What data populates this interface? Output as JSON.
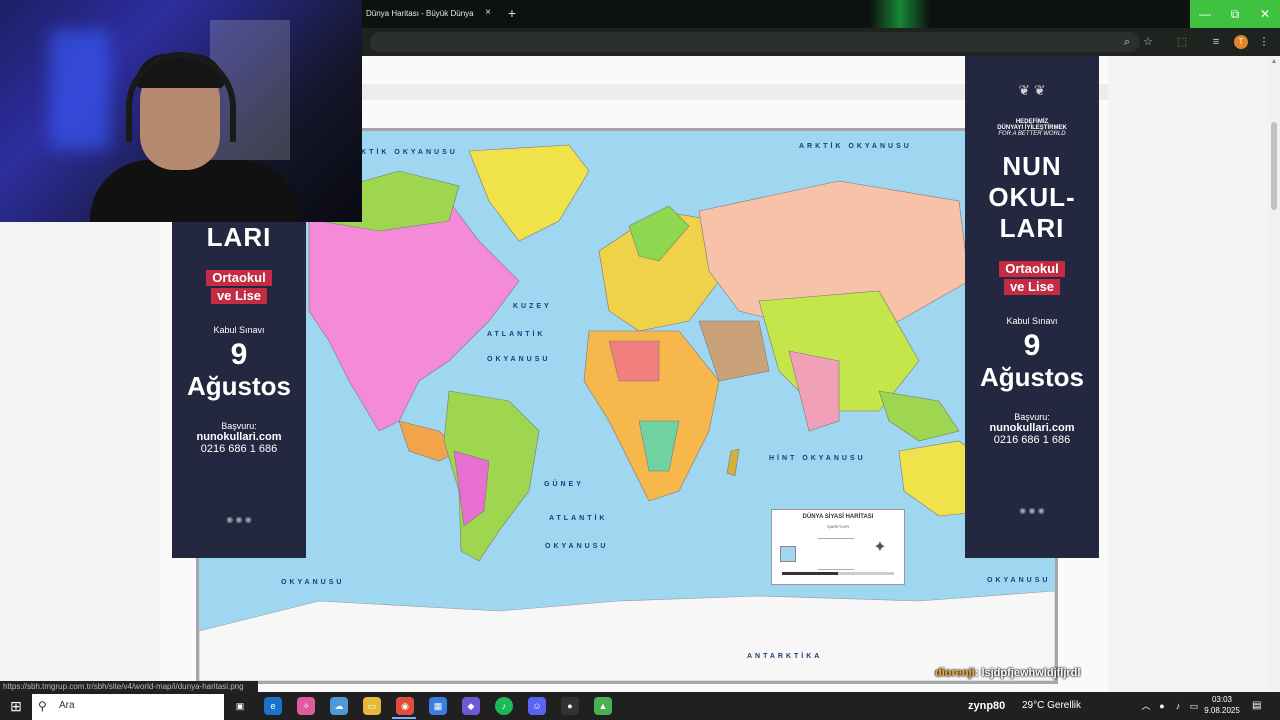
{
  "browser": {
    "tab_title": "Dünya Haritası - Büyük Dünya",
    "tab_close": "×",
    "new_tab": "+",
    "profile_initial": "T",
    "window_buttons": [
      "—",
      "⧉",
      "✕"
    ],
    "status_url": "https://sbh.tmgrup.com.tr/sbh/site/v4/world-map/i/dunya-haritasi.png"
  },
  "map": {
    "oceans": [
      "ARKTİK OKYANUSU",
      "ARKTİK OKYANUSU",
      "KUZEY",
      "ATLANTİK",
      "OKYANUSU",
      "HİNT OKYANUSU",
      "GÜNEY",
      "ATLANTİK",
      "OKYANUSU",
      "ANTARKTİKA",
      "OKYANUSU",
      "OKYANUSU"
    ],
    "legend_title": "DÜNYA SİYASİ HARİTASI",
    "legend_sub": "İŞARETLER"
  },
  "ad_left": {
    "title_part": "LARI",
    "red": [
      "Ortaokul",
      "ve Lise"
    ],
    "exam": "Kabul Sınavı",
    "day": "9",
    "month": "Ağustos",
    "apply": "Başvuru:",
    "site": "nunokullari.com",
    "phone": "0216 686 1 686"
  },
  "ad_right": {
    "slogan1": "HEDEFİMİZ",
    "slogan2": "DÜNYAYI İYİLEŞTİRMEK",
    "slogan3": "FOR A BETTER WORLD",
    "title": [
      "NUN",
      "OKUL-",
      "LARI"
    ],
    "red": [
      "Ortaokul",
      "ve Lise"
    ],
    "exam": "Kabul Sınavı",
    "day": "9",
    "month": "Ağustos",
    "apply": "Başvuru:",
    "site": "nunokullari.com",
    "phone": "0216 686 1 686"
  },
  "chat": {
    "user": "diorenji",
    "message": ": lsjdpfjewhwldjfljrdl"
  },
  "taskbar": {
    "search_placeholder": "Ara",
    "tray_user": "zynp80",
    "weather": "29°C Gerellik",
    "time": "03:03",
    "date": "9.08.2025"
  }
}
